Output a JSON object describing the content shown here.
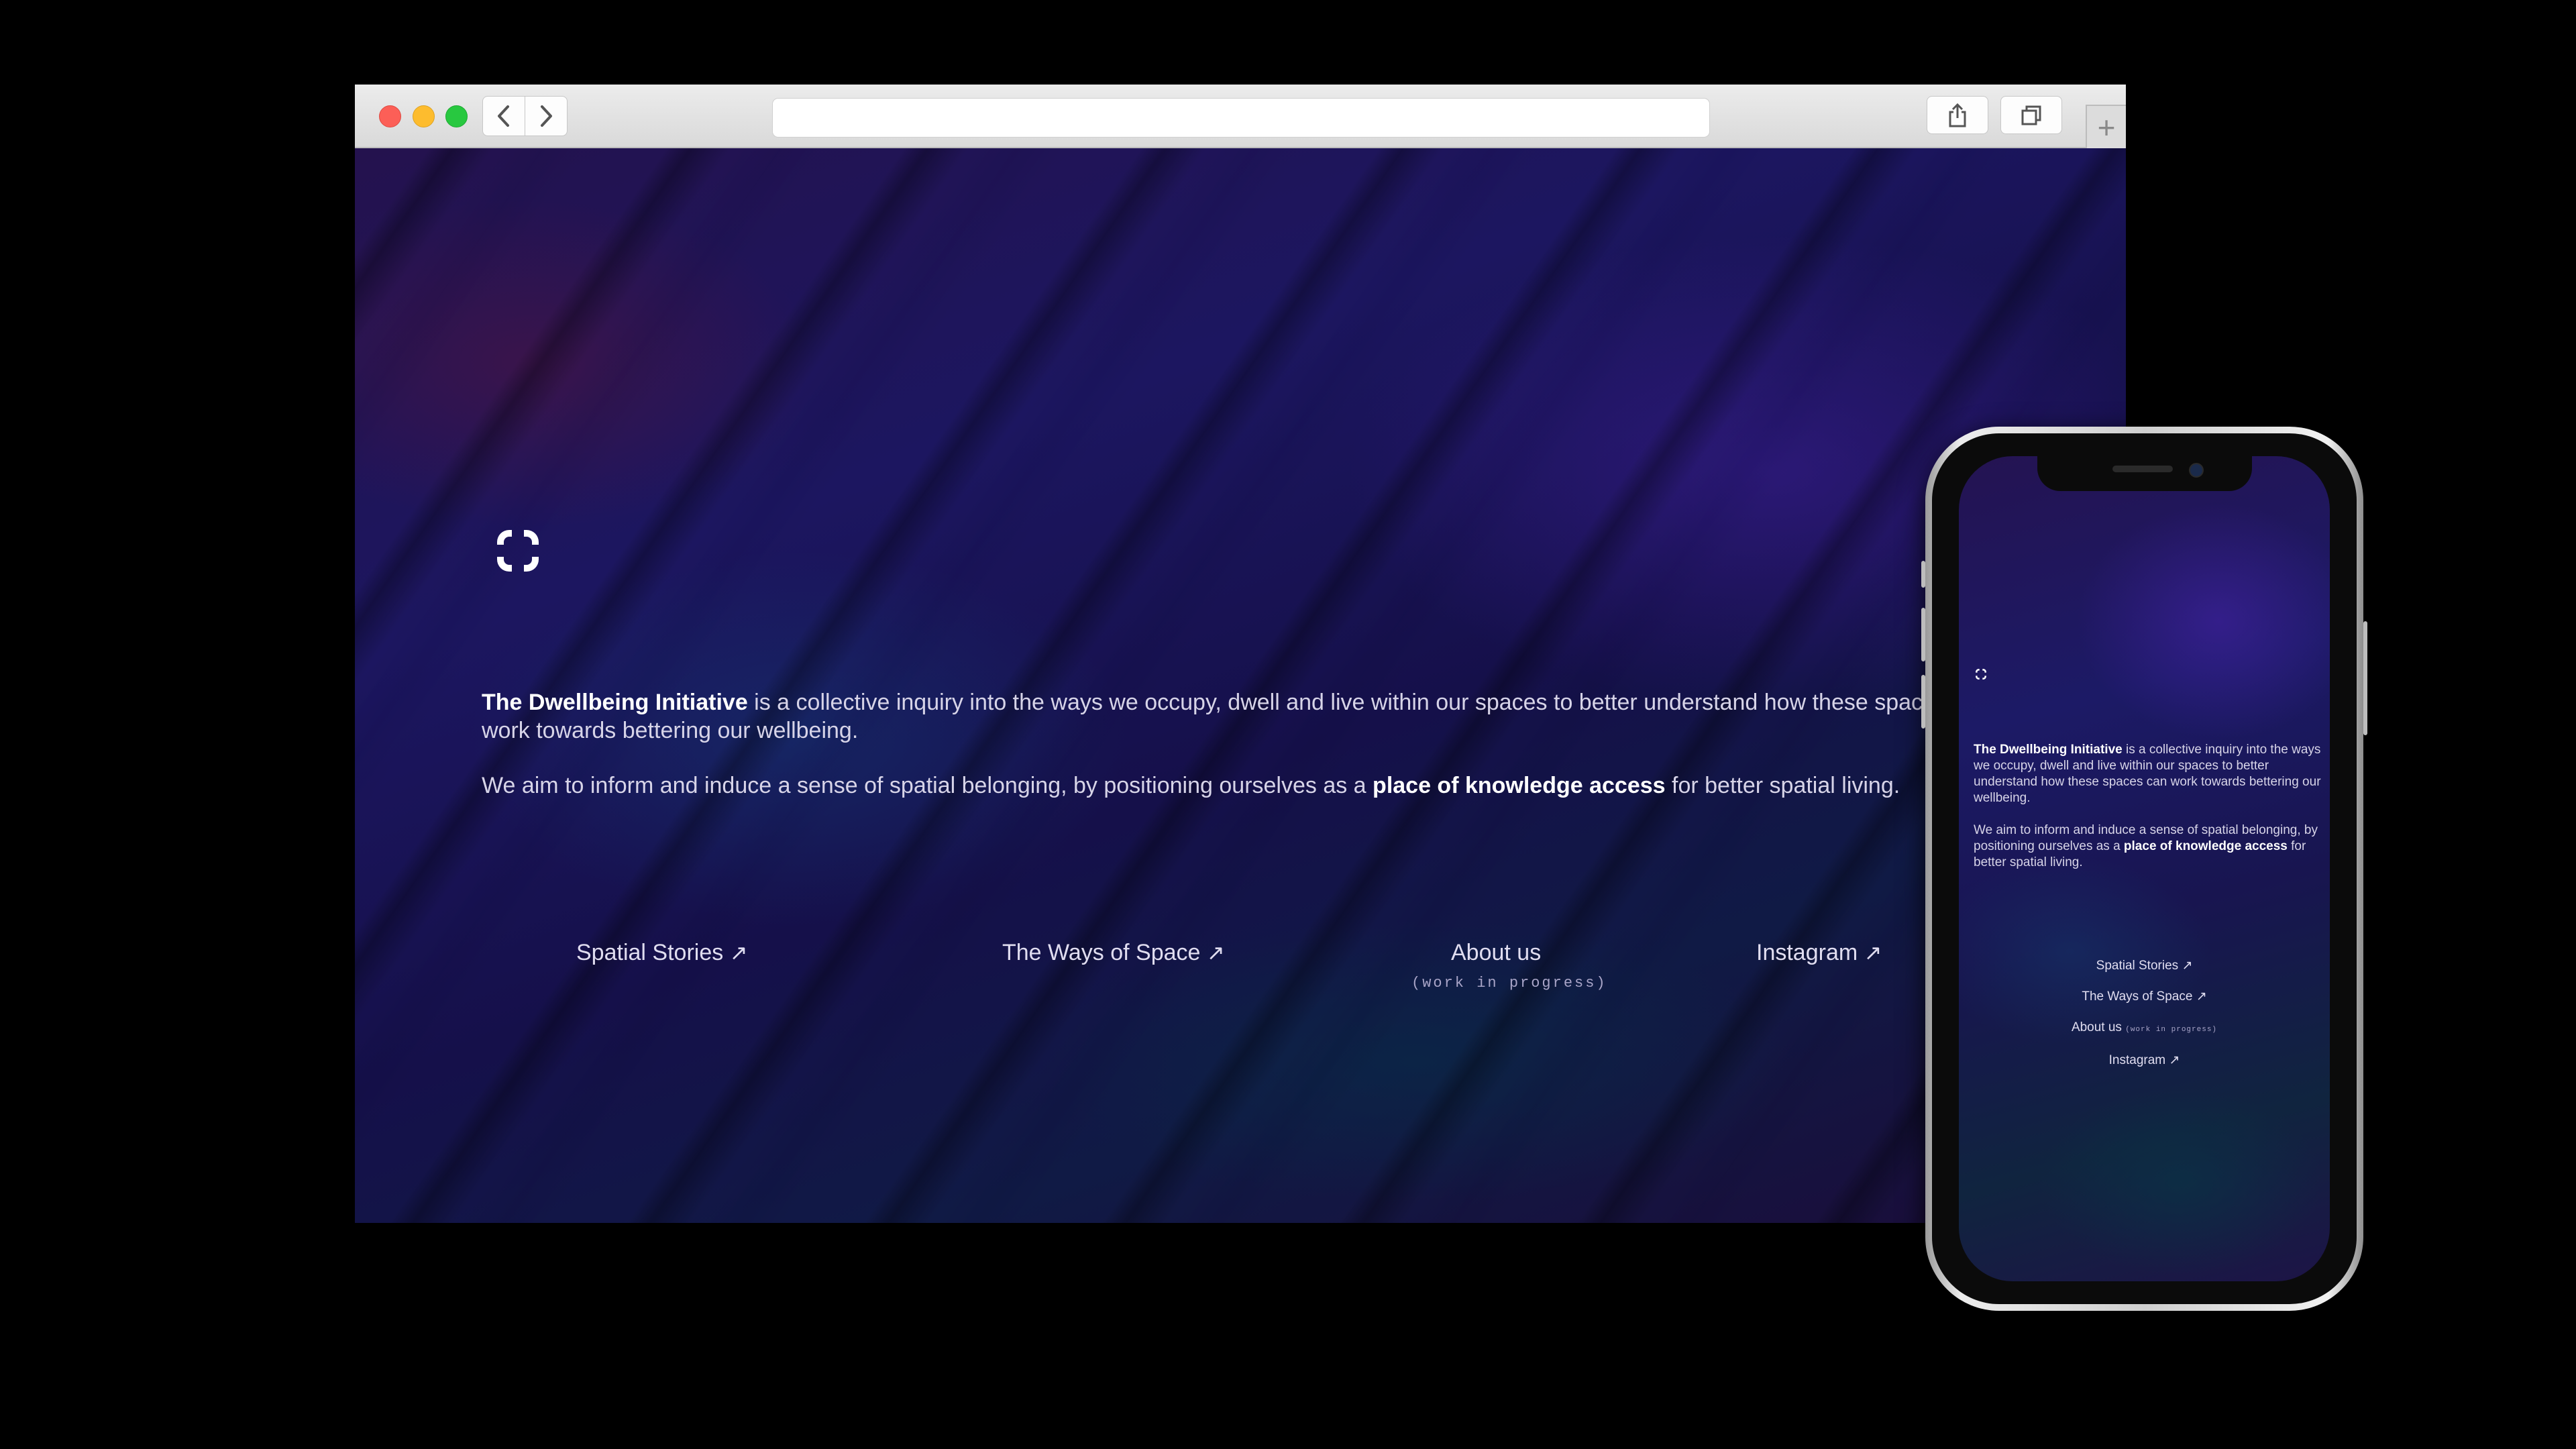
{
  "browser": {
    "address_value": "",
    "new_tab_label": "+",
    "back_icon": "chevron-left-icon",
    "forward_icon": "chevron-right-icon",
    "share_icon": "share-icon",
    "tabs_icon": "tabs-overview-icon"
  },
  "site": {
    "logo_icon": "four-corner-mark-icon",
    "intro": {
      "p1_strong": "The Dwellbeing Initiative",
      "p1_rest": " is a collective inquiry into the ways we occupy, dwell and live within our spaces to better understand how these spaces can work towards bettering our wellbeing.",
      "p2_start": "We aim to inform and induce a sense of spatial belonging, by positioning ourselves as a ",
      "p2_strong": "place of knowledge access",
      "p2_end": " for better spatial living."
    },
    "links": {
      "spatial_stories": "Spatial Stories",
      "ways_of_space": "The Ways of Space",
      "about_us": "About us",
      "about_note": "(work in progress)",
      "instagram": "Instagram",
      "arrow": "↗"
    }
  },
  "colors": {
    "page_bg": "#000000",
    "accent_text": "#ffffff",
    "body_text": "#d7d4e8",
    "muted_text": "#a9a5c8"
  }
}
